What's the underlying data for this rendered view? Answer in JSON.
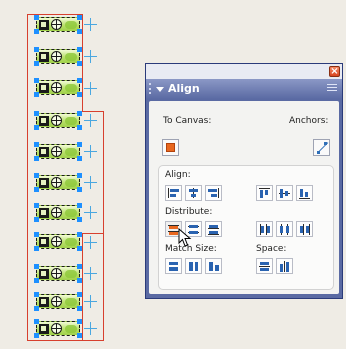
{
  "panel": {
    "title": "Align",
    "to_canvas_label": "To Canvas:",
    "anchors_label": "Anchors:",
    "align_label": "Align:",
    "distribute_label": "Distribute:",
    "match_size_label": "Match Size:",
    "space_label": "Space:",
    "close_glyph": "×"
  },
  "icons": {
    "close": "close-icon",
    "options": "options-menu-icon",
    "collapse": "collapse-triangle-icon",
    "canvas": "to-canvas-icon",
    "anchors": "anchors-icon"
  },
  "colors": {
    "panel_frame": "#5a6aa3",
    "item_fill": "#b9e06a",
    "guide_red": "#d7402e",
    "selection_handle": "#1e90ff",
    "accent_orange": "#e8671f",
    "icon_blue": "#2a63b0"
  },
  "canvas": {
    "item_count": 11
  }
}
